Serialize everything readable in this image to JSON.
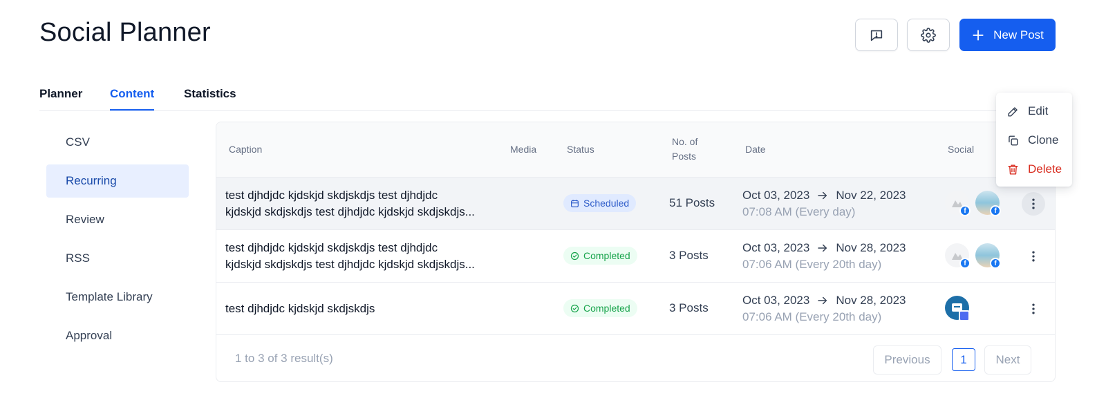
{
  "header": {
    "title": "Social Planner",
    "new_post_label": "New Post"
  },
  "tabs": [
    {
      "label": "Planner",
      "active": false
    },
    {
      "label": "Content",
      "active": true
    },
    {
      "label": "Statistics",
      "active": false
    }
  ],
  "sidebar": {
    "items": [
      {
        "label": "CSV",
        "active": false
      },
      {
        "label": "Recurring",
        "active": true
      },
      {
        "label": "Review",
        "active": false
      },
      {
        "label": "RSS",
        "active": false
      },
      {
        "label": "Template Library",
        "active": false
      },
      {
        "label": "Approval",
        "active": false
      }
    ]
  },
  "table": {
    "columns": {
      "caption": "Caption",
      "media": "Media",
      "status": "Status",
      "posts_line1": "No. of",
      "posts_line2": "Posts",
      "date": "Date",
      "social": "Social"
    },
    "rows": [
      {
        "caption_line1": "test djhdjdc kjdskjd skdjskdjs test djhdjdc",
        "caption_line2": "kjdskjd skdjskdjs test djhdjdc kjdskjd skdjskdjs...",
        "status": "Scheduled",
        "posts": "51 Posts",
        "date_start": "Oct 03, 2023",
        "date_end": "Nov 22, 2023",
        "time": "07:08 AM (Every day)"
      },
      {
        "caption_line1": "test djhdjdc kjdskjd skdjskdjs test djhdjdc",
        "caption_line2": "kjdskjd skdjskdjs test djhdjdc kjdskjd skdjskdjs...",
        "status": "Completed",
        "posts": "3 Posts",
        "date_start": "Oct 03, 2023",
        "date_end": "Nov 28, 2023",
        "time": "07:06 AM (Every 20th day)"
      },
      {
        "caption_line1": "test djhdjdc kjdskjd skdjskdjs",
        "caption_line2": "",
        "status": "Completed",
        "posts": "3 Posts",
        "date_start": "Oct 03, 2023",
        "date_end": "Nov 28, 2023",
        "time": "07:06 AM (Every 20th day)"
      }
    ]
  },
  "pagination": {
    "result_text": "1 to 3 of 3 result(s)",
    "previous": "Previous",
    "page": "1",
    "next": "Next"
  },
  "context_menu": {
    "edit": "Edit",
    "clone": "Clone",
    "delete": "Delete"
  },
  "colors": {
    "primary": "#155eef",
    "danger": "#d92d20",
    "success": "#16a34a",
    "sidebar_active_bg": "#e8efff"
  },
  "icons": [
    "feedback-icon",
    "gear-icon",
    "plus-icon",
    "calendar-icon",
    "check-circle-icon",
    "arrow-right-icon",
    "facebook-icon",
    "more-vertical-icon",
    "pencil-icon",
    "copy-icon",
    "trash-icon"
  ]
}
